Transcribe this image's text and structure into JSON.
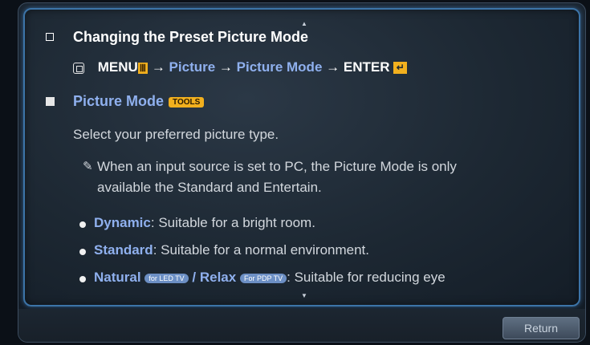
{
  "section": {
    "title": "Changing the Preset Picture Mode",
    "path": {
      "menu": "MENU",
      "arrow": "→",
      "picture": "Picture",
      "picture_mode": "Picture Mode",
      "enter": "ENTER"
    }
  },
  "subsection": {
    "title": "Picture Mode",
    "tools_badge": "TOOLS"
  },
  "description": "Select your preferred picture type.",
  "note": {
    "line1": "When an input source is set to PC, the Picture Mode is only",
    "line2": "available the Standard and Entertain."
  },
  "modes": [
    {
      "name": "Dynamic",
      "desc": ": Suitable for a bright room."
    },
    {
      "name": "Standard",
      "desc": ": Suitable for a normal environment."
    },
    {
      "name": "Natural",
      "badge1": "for LED TV",
      "sep": " / ",
      "name2": "Relax",
      "badge2": "For PDP TV",
      "desc": ": Suitable for reducing eye"
    }
  ],
  "footer": {
    "return_label": "Return"
  },
  "colors": {
    "accent_blue": "#8fb0ee",
    "tools_yellow": "#f2b01e",
    "panel_border": "#3c74a8"
  }
}
